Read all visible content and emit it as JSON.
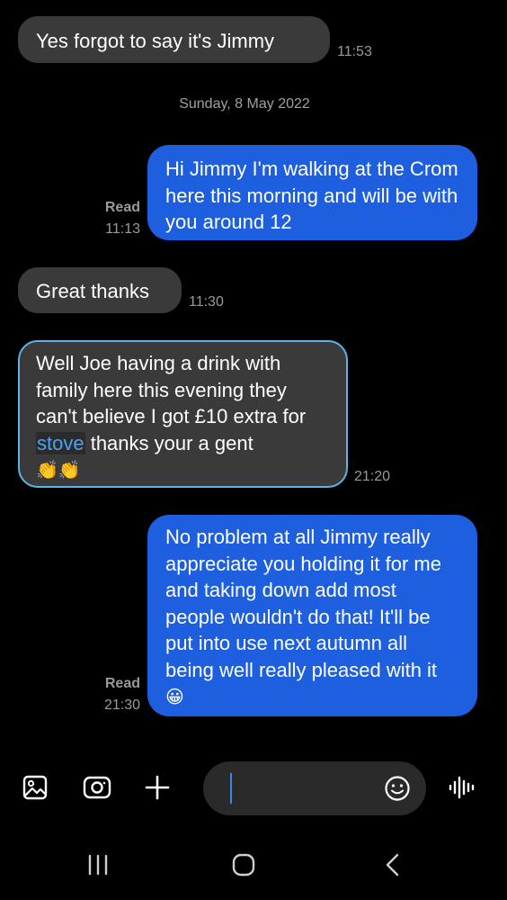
{
  "messages": [
    {
      "id": "m1",
      "text": "Yes forgot to say it's Jimmy",
      "time": "11:53"
    },
    {
      "id": "date",
      "text": "Sunday, 8 May 2022"
    },
    {
      "id": "m2",
      "text": "Hi Jimmy I'm walking at the Crom here this morning and will be with you around 12",
      "status": "Read",
      "time": "11:13"
    },
    {
      "id": "m3",
      "text": "Great thanks",
      "time": "11:30"
    },
    {
      "id": "m4",
      "text_before": "Well Joe having a drink with family here this evening they can't believe I got £10 extra for ",
      "highlight": "stove",
      "text_after": " thanks your a gent",
      "emoji": "👏👏",
      "time": "21:20"
    },
    {
      "id": "m5",
      "text": "No problem at all Jimmy really appreciate you holding it for me and taking down add most people wouldn't do that! It'll be put into use next autumn all being well really pleased with it",
      "emoji": "😀",
      "status": "Read",
      "time": "21:30"
    }
  ],
  "composer": {
    "icons": [
      "gallery-icon",
      "camera-icon",
      "plus-icon",
      "emoji-icon",
      "voice-icon"
    ],
    "input_value": ""
  },
  "navbar": {
    "icons": [
      "recent-apps-icon",
      "home-icon",
      "back-icon"
    ]
  },
  "colors": {
    "outgoing_bubble": "#1d5fdf",
    "incoming_bubble": "#3a3a3a",
    "selection_border": "#5bb4e8",
    "highlight_text": "#4fa2ef"
  }
}
